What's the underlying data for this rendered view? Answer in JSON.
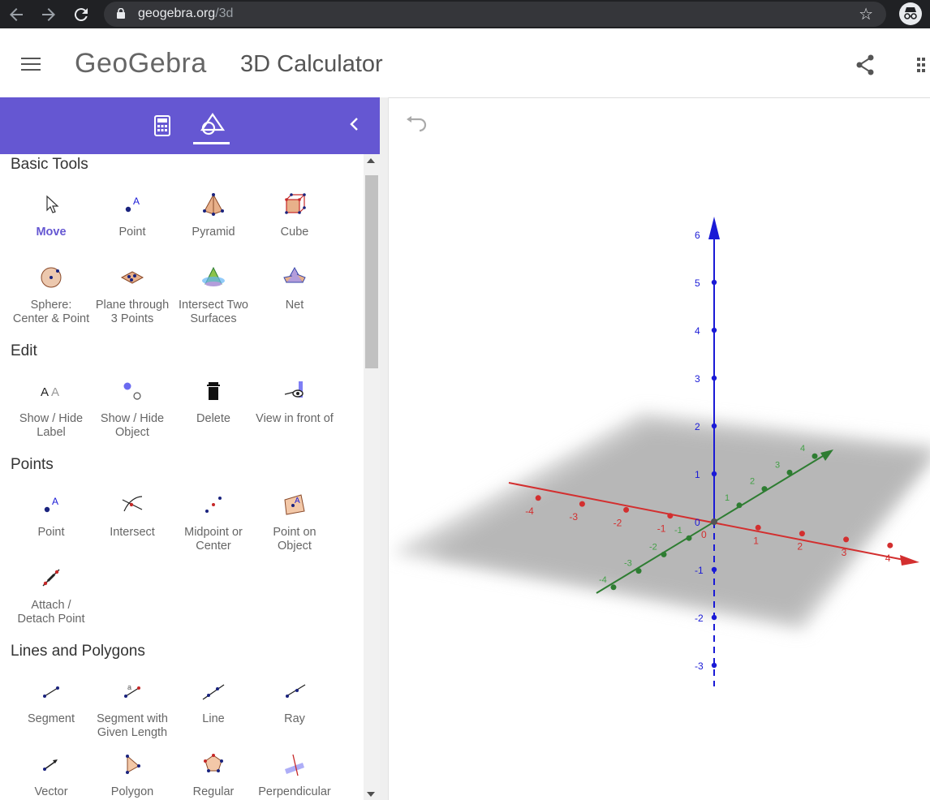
{
  "browser": {
    "url_domain": "geogebra.org",
    "url_path": "/3d",
    "back_icon": "arrow-left-icon",
    "forward_icon": "arrow-right-icon",
    "reload_icon": "reload-icon",
    "bookmark_icon": "star-icon",
    "profile_icon": "incognito-icon"
  },
  "header": {
    "logo": "GeoGebra",
    "title": "3D Calculator",
    "menu_icon": "hamburger-icon",
    "share_icon": "share-icon",
    "apps_icon": "apps-grid-icon"
  },
  "panel": {
    "accent": "#6557d2",
    "tabs": [
      {
        "icon": "calculator-icon",
        "active": false
      },
      {
        "icon": "tools-icon",
        "active": true
      }
    ],
    "collapse_icon": "chevron-left-icon"
  },
  "sections": [
    {
      "title": "Basic Tools",
      "tools": [
        {
          "line1": "Move",
          "line2": "",
          "icon": "move-icon",
          "selected": true
        },
        {
          "line1": "Point",
          "line2": "",
          "icon": "point-icon"
        },
        {
          "line1": "Pyramid",
          "line2": "",
          "icon": "pyramid-icon"
        },
        {
          "line1": "Cube",
          "line2": "",
          "icon": "cube-icon"
        },
        {
          "line1": "Sphere:",
          "line2": "Center & Point",
          "icon": "sphere-icon"
        },
        {
          "line1": "Plane through",
          "line2": "3 Points",
          "icon": "plane-3-points-icon"
        },
        {
          "line1": "Intersect Two",
          "line2": "Surfaces",
          "icon": "intersect-surfaces-icon"
        },
        {
          "line1": "Net",
          "line2": "",
          "icon": "net-icon"
        }
      ]
    },
    {
      "title": "Edit",
      "tools": [
        {
          "line1": "Show / Hide",
          "line2": "Label",
          "icon": "show-hide-label-icon"
        },
        {
          "line1": "Show / Hide",
          "line2": "Object",
          "icon": "show-hide-object-icon"
        },
        {
          "line1": "Delete",
          "line2": "",
          "icon": "delete-icon"
        },
        {
          "line1": "View in front of",
          "line2": "",
          "icon": "view-in-front-icon"
        }
      ]
    },
    {
      "title": "Points",
      "tools": [
        {
          "line1": "Point",
          "line2": "",
          "icon": "point-icon"
        },
        {
          "line1": "Intersect",
          "line2": "",
          "icon": "intersect-icon"
        },
        {
          "line1": "Midpoint or",
          "line2": "Center",
          "icon": "midpoint-icon"
        },
        {
          "line1": "Point on",
          "line2": "Object",
          "icon": "point-on-object-icon"
        },
        {
          "line1": "Attach /",
          "line2": "Detach Point",
          "icon": "attach-detach-icon"
        }
      ]
    },
    {
      "title": "Lines and Polygons",
      "tools": [
        {
          "line1": "Segment",
          "line2": "",
          "icon": "segment-icon"
        },
        {
          "line1": "Segment with",
          "line2": "Given Length",
          "icon": "segment-length-icon"
        },
        {
          "line1": "Line",
          "line2": "",
          "icon": "line-icon"
        },
        {
          "line1": "Ray",
          "line2": "",
          "icon": "ray-icon"
        },
        {
          "line1": "Vector",
          "line2": "",
          "icon": "vector-icon"
        },
        {
          "line1": "Polygon",
          "line2": "",
          "icon": "polygon-icon"
        },
        {
          "line1": "Regular",
          "line2": "",
          "icon": "regular-polygon-icon"
        },
        {
          "line1": "Perpendicular",
          "line2": "",
          "icon": "perpendicular-icon"
        }
      ]
    }
  ],
  "graphics3d": {
    "undo_icon": "undo-icon",
    "colors": {
      "x_axis": "#d32f2f",
      "y_axis": "#2e7d32",
      "z_axis": "#1a1ad6",
      "plane": "#b0b0b0"
    },
    "x_ticks": [
      "-4",
      "-3",
      "-2",
      "-1",
      "0",
      "1",
      "2",
      "3",
      "4"
    ],
    "y_ticks": [
      "-4",
      "-3",
      "-2",
      "-1",
      "1",
      "2",
      "3",
      "4"
    ],
    "z_ticks": [
      "6",
      "5",
      "4",
      "3",
      "2",
      "1",
      "0",
      "-1",
      "-2",
      "-3"
    ]
  }
}
